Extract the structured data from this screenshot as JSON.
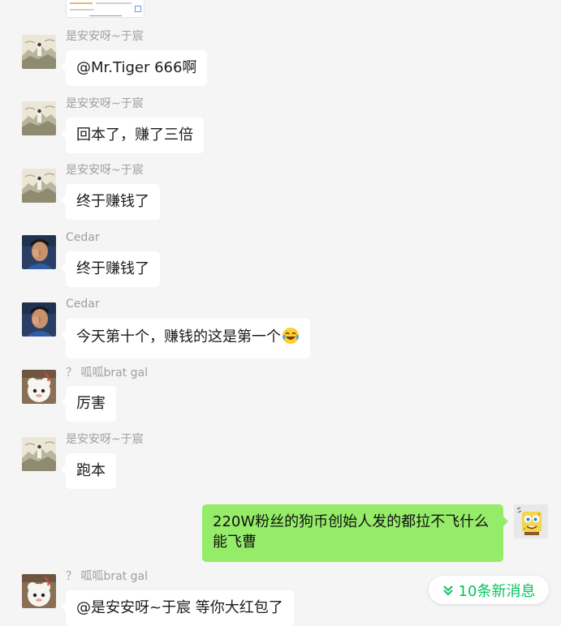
{
  "colors": {
    "background": "#f5f5f5",
    "incoming_bubble": "#ffffff",
    "outgoing_bubble": "#95ec69",
    "sender_name": "#9e9e9e",
    "accent": "#07c160"
  },
  "messages": [
    {
      "sender": "是安安呀~于宸",
      "avatar": "landscape-painting",
      "text": "@Mr.Tiger 666啊"
    },
    {
      "sender": "是安安呀~于宸",
      "avatar": "landscape-painting",
      "text": "回本了，赚了三倍"
    },
    {
      "sender": "是安安呀~于宸",
      "avatar": "landscape-painting",
      "text": "终于赚钱了"
    },
    {
      "sender": "Cedar",
      "avatar": "person-photo",
      "text": "终于赚钱了"
    },
    {
      "sender": "Cedar",
      "avatar": "person-photo",
      "text": "今天第十个，赚钱的这是第一个",
      "emoji": "laughing-crying-emoji"
    },
    {
      "sender": "？ 呱呱brat gal",
      "avatar": "cartoon-sheep",
      "text": "厉害"
    },
    {
      "sender": "是安安呀~于宸",
      "avatar": "landscape-painting",
      "text": "跑本"
    },
    {
      "sender": "",
      "avatar": "spongebob",
      "text": "220W粉丝的狗币创始人发的都拉不飞什么能飞曹",
      "outgoing": true
    },
    {
      "sender": "？ 呱呱brat gal",
      "avatar": "cartoon-sheep",
      "text": "@是安安呀~于宸 等你大红包了"
    }
  ],
  "new_messages": {
    "label": "10条新消息",
    "icon": "double-chevron-down-icon"
  }
}
